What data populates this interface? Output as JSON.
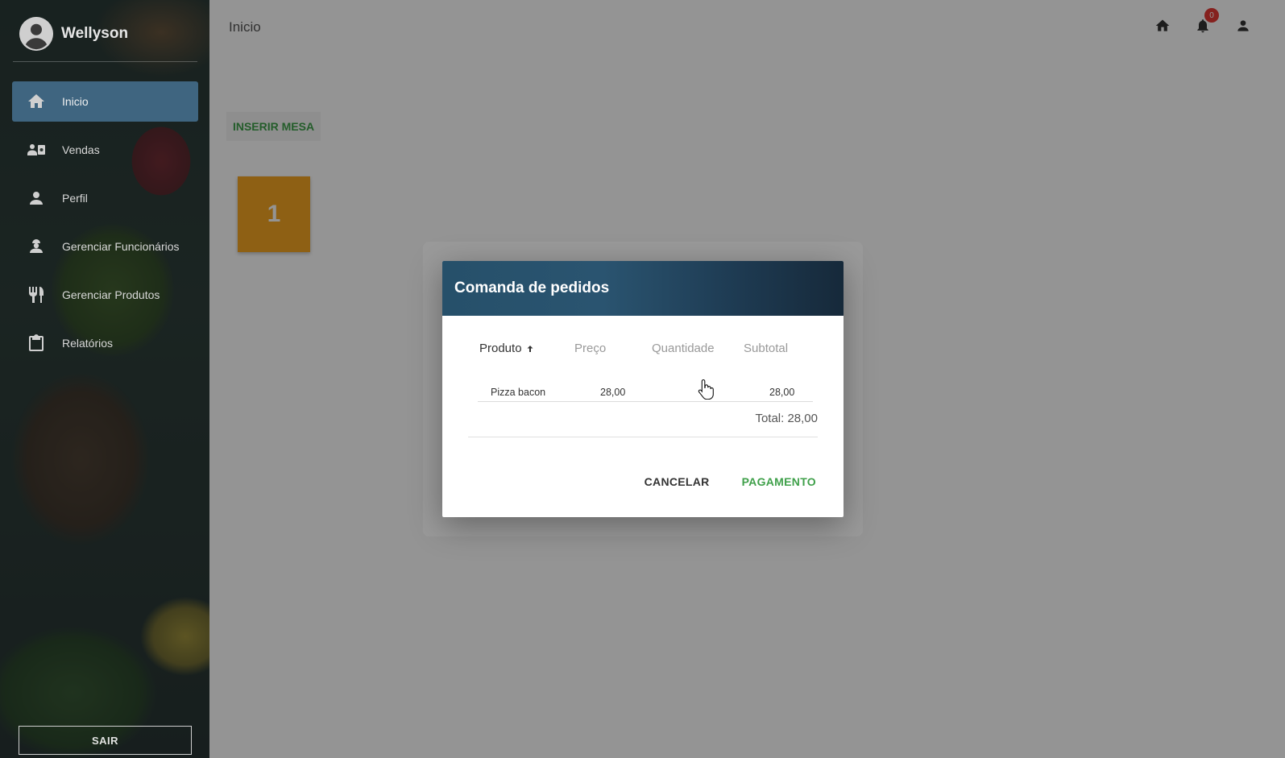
{
  "sidebar": {
    "user_name": "Wellyson",
    "items": [
      {
        "label": "Inicio",
        "icon": "home-icon",
        "active": true
      },
      {
        "label": "Vendas",
        "icon": "sales-icon",
        "active": false
      },
      {
        "label": "Perfil",
        "icon": "person-icon",
        "active": false
      },
      {
        "label": "Gerenciar Funcionários",
        "icon": "worker-icon",
        "active": false
      },
      {
        "label": "Gerenciar Produtos",
        "icon": "restaurant-icon",
        "active": false
      },
      {
        "label": "Relatórios",
        "icon": "clipboard-icon",
        "active": false
      }
    ],
    "logout_label": "SAIR"
  },
  "header": {
    "title": "Inicio",
    "notification_count": "0"
  },
  "main": {
    "insert_button_label": "INSERIR MESA",
    "tables": [
      "1"
    ]
  },
  "dialog": {
    "title": "Comanda de pedidos",
    "columns": [
      "Produto",
      "Preço",
      "Quantidade",
      "Subtotal"
    ],
    "rows": [
      {
        "produto": "Pizza bacon",
        "preco": "28,00",
        "quantidade": "",
        "subtotal": "28,00"
      }
    ],
    "total_label": "Total: 28,00",
    "cancel_label": "CANCELAR",
    "payment_label": "PAGAMENTO"
  },
  "colors": {
    "accent_green": "#3fa04a",
    "table_card": "#f5a623",
    "nav_active": "#3f6580",
    "badge": "#e53935"
  }
}
